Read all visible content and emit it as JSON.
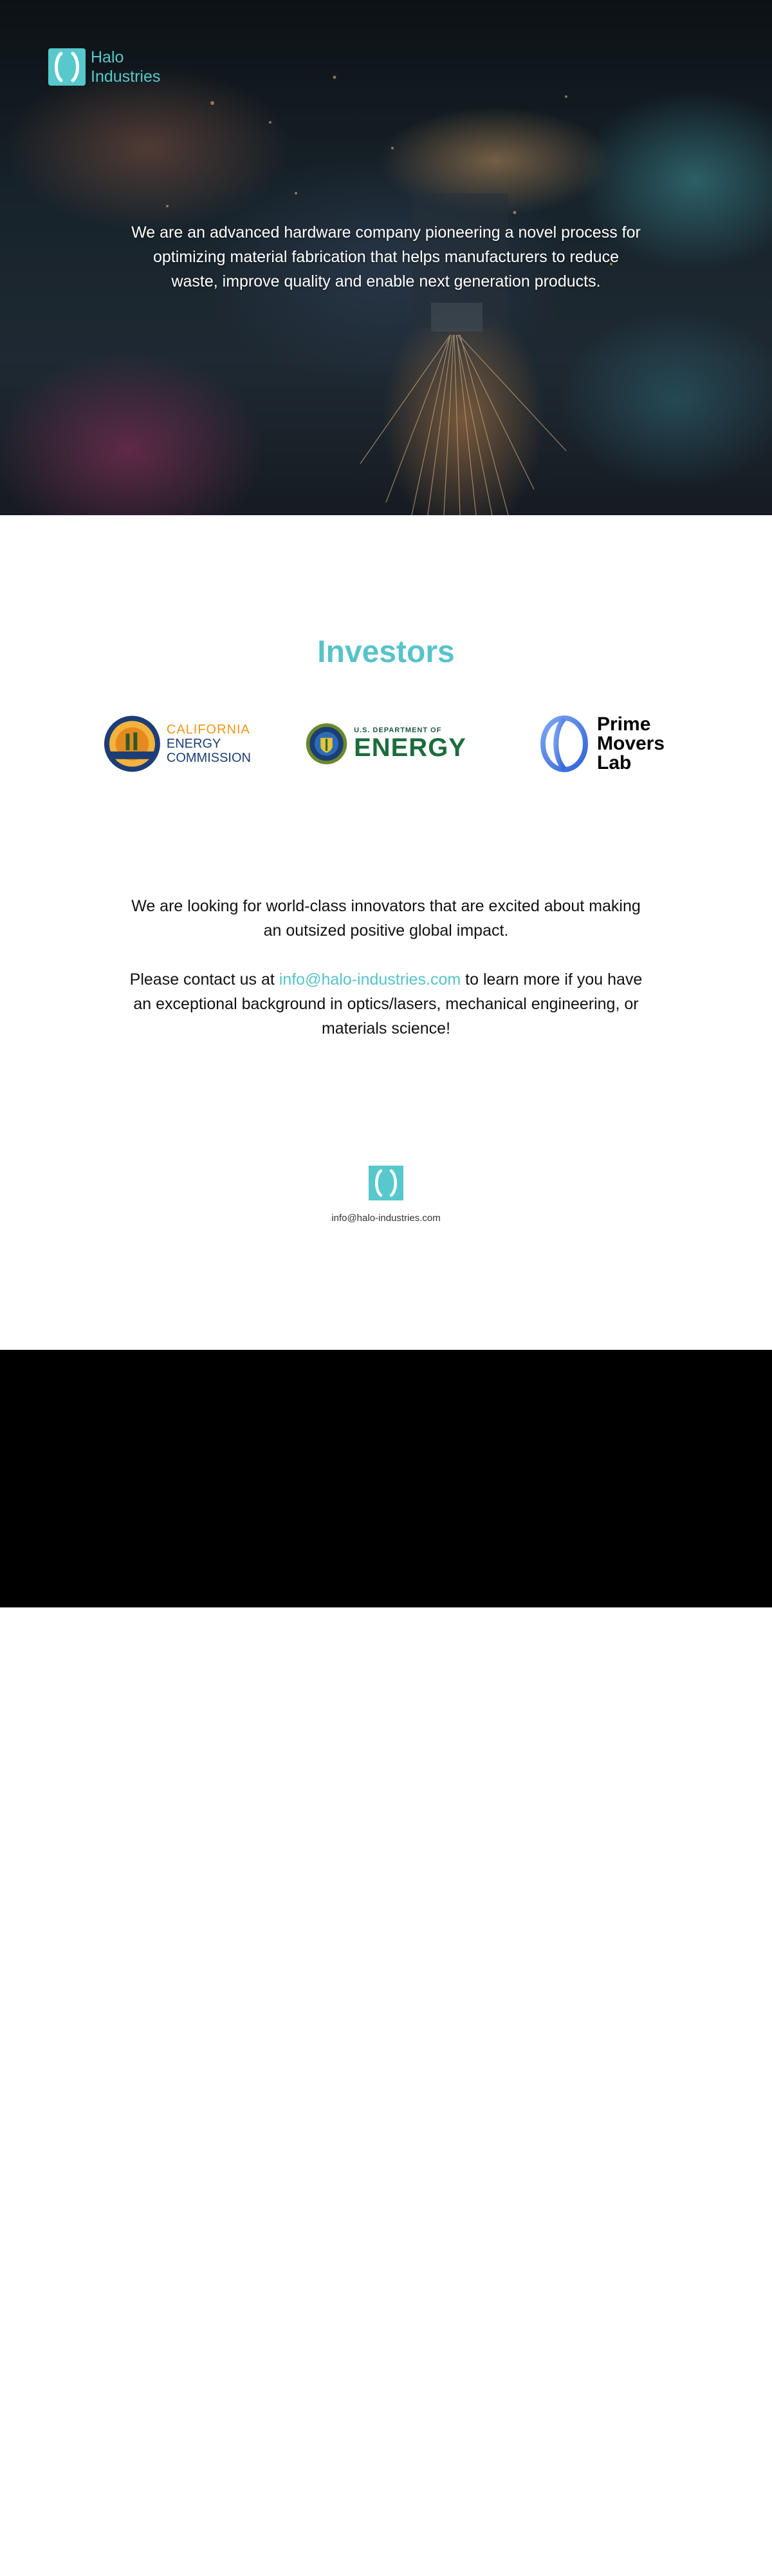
{
  "brand": {
    "name_line1": "Halo",
    "name_line2": "Industries",
    "accent_color": "#57c3c9",
    "logo_icon": "halo-logo-icon"
  },
  "hero": {
    "intro": "We are an advanced hardware company pioneering a novel process for optimizing material fabrication that helps manufacturers to reduce waste, improve quality and enable next generation products.",
    "background": "laser-cutting-sparks-photo"
  },
  "investors": {
    "title": "Investors",
    "items": [
      {
        "name": "California Energy Commission",
        "line1": "CALIFORNIA",
        "line2": "ENERGY",
        "line3": "COMMISSION",
        "icon": "cec-seal-icon"
      },
      {
        "name": "U.S. Department of Energy",
        "line1": "U.S. DEPARTMENT OF",
        "line2": "ENERGY",
        "icon": "doe-seal-icon"
      },
      {
        "name": "Prime Movers Lab",
        "line1": "Prime",
        "line2": "Movers",
        "line3": "Lab",
        "icon": "pml-logo-icon"
      }
    ]
  },
  "contact": {
    "paragraph1": "We are looking for world-class innovators that are excited about making an outsized positive global impact.",
    "paragraph2_before": "Please contact us at ",
    "email": "info@halo-industries.com",
    "paragraph2_after": " to learn more if you have an exceptional background in optics/lasers, mechanical engineering, or materials science!"
  },
  "footer": {
    "email": "info@halo-industries.com",
    "logo_icon": "halo-logo-icon"
  }
}
